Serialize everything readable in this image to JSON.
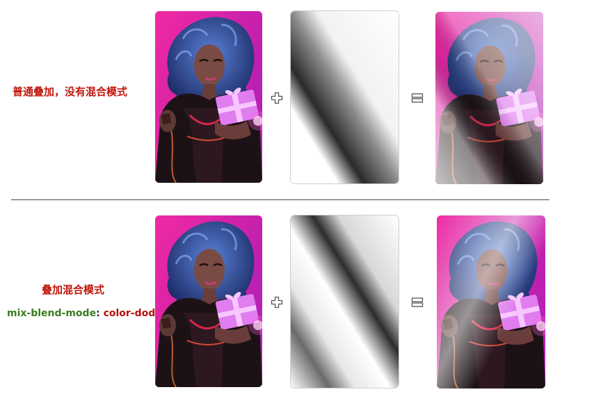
{
  "rows": {
    "top": {
      "label": "普通叠加，没有混合模式"
    },
    "bottom": {
      "label": "叠加混合模式",
      "css_property": "mix-blend-mode",
      "css_colon": ":",
      "css_value": "color-dodge"
    }
  },
  "icons": {
    "plus": "plus-icon",
    "equals": "equals-icon"
  },
  "colors": {
    "label_red": "#c0180c",
    "property_green": "#3a7d1f",
    "value_red": "#b5130a",
    "bg_magenta": "#e0208a",
    "bg_violet": "#7a1fd6"
  }
}
